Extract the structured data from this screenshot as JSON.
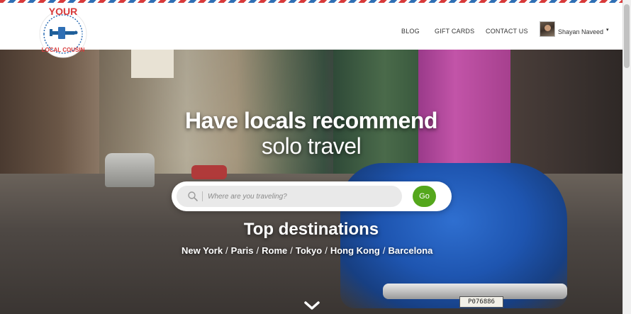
{
  "header": {
    "logo": {
      "line1": "YOUR",
      "line2": "LOCAL COUSIN",
      "icon": "airplane-icon"
    },
    "nav": [
      {
        "label": "BLOG"
      },
      {
        "label": "GIFT CARDS"
      },
      {
        "label": "CONTACT US"
      }
    ],
    "user": {
      "name": "Shayan Naveed",
      "caret": "▾"
    }
  },
  "hero": {
    "headline_line1": "Have locals recommend",
    "headline_line2": "solo travel",
    "search": {
      "placeholder": "Where are you traveling?",
      "value": "",
      "go_label": "Go"
    },
    "top_destinations_title": "Top destinations",
    "destinations": [
      "New York",
      "Paris",
      "Rome",
      "Tokyo",
      "Hong Kong",
      "Barcelona"
    ],
    "separator": "/",
    "plate_text": "P076886"
  },
  "colors": {
    "brand_red": "#d83a3a",
    "brand_blue": "#2f6fb5",
    "go_green": "#54a71c"
  }
}
